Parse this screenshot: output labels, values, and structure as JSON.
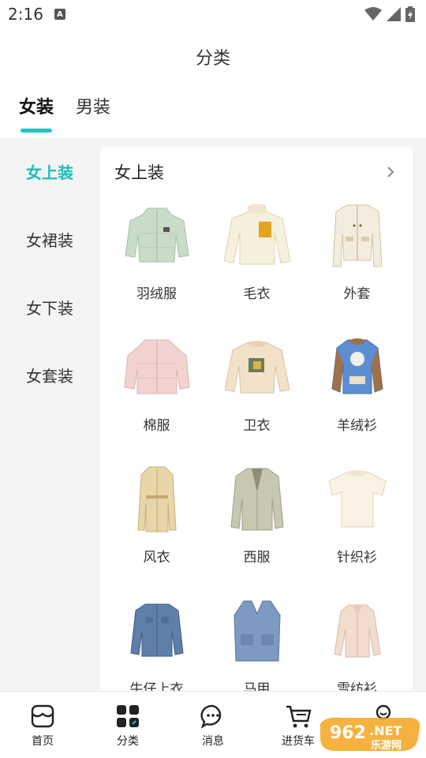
{
  "status_bar": {
    "time": "2:16",
    "notification_letter": "A"
  },
  "header": {
    "title": "分类"
  },
  "tabs": [
    {
      "label": "女装",
      "active": true
    },
    {
      "label": "男装",
      "active": false
    }
  ],
  "sidebar": {
    "items": [
      {
        "label": "女上装",
        "active": true
      },
      {
        "label": "女裙装",
        "active": false
      },
      {
        "label": "女下装",
        "active": false
      },
      {
        "label": "女套装",
        "active": false
      }
    ]
  },
  "panel": {
    "title": "女上装",
    "items": [
      {
        "label": "羽绒服",
        "icon": "down-jacket-icon"
      },
      {
        "label": "毛衣",
        "icon": "sweater-icon"
      },
      {
        "label": "外套",
        "icon": "coat-icon"
      },
      {
        "label": "棉服",
        "icon": "padded-jacket-icon"
      },
      {
        "label": "卫衣",
        "icon": "sweatshirt-icon"
      },
      {
        "label": "羊绒衫",
        "icon": "cashmere-sweater-icon"
      },
      {
        "label": "风衣",
        "icon": "trench-coat-icon"
      },
      {
        "label": "西服",
        "icon": "blazer-icon"
      },
      {
        "label": "针织衫",
        "icon": "knit-top-icon"
      },
      {
        "label": "牛仔上衣",
        "icon": "denim-jacket-icon"
      },
      {
        "label": "马甲",
        "icon": "vest-icon"
      },
      {
        "label": "雪纺衫",
        "icon": "chiffon-shirt-icon"
      }
    ]
  },
  "bottom_nav": [
    {
      "label": "首页",
      "icon": "home-store-icon"
    },
    {
      "label": "分类",
      "icon": "category-grid-icon",
      "active": true
    },
    {
      "label": "消息",
      "icon": "message-bubble-icon"
    },
    {
      "label": "进货车",
      "icon": "cart-icon"
    },
    {
      "label": "",
      "icon": "profile-icon"
    }
  ],
  "watermark": {
    "text": "962.NET 乐游网"
  },
  "colors": {
    "accent": "#1fc6c1",
    "background": "#f3f5f5",
    "panel": "#ffffff"
  }
}
